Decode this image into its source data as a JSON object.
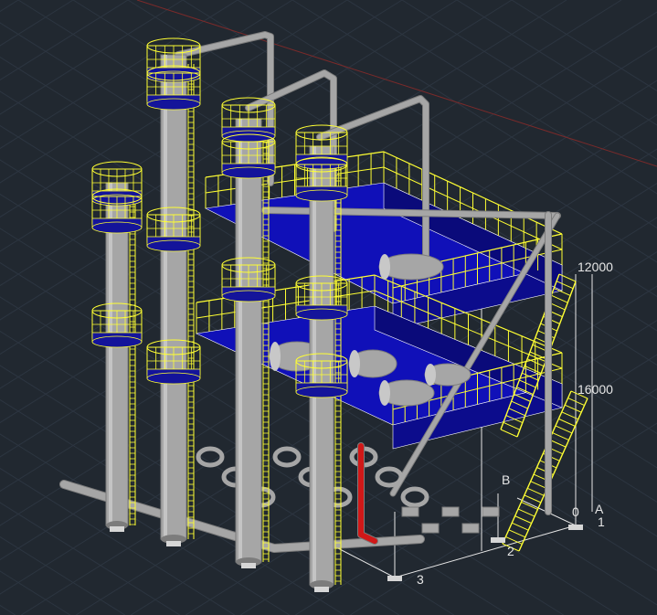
{
  "viewport": {
    "title": "",
    "background_color": "#212830",
    "grid_color": "#2c3540",
    "axis_color": "#7a2a2a"
  },
  "colors": {
    "platform": "#1010b8",
    "railing": "#ffff33",
    "pipe": "#a6a6a6",
    "pipe_dark": "#7c7c7c",
    "column_band": "#14149a",
    "highlight_pipe": "#d01818",
    "dimension": "#e6e6e6"
  },
  "annotations": {
    "elevation_upper": "12000",
    "elevation_lower": "16000",
    "grid_label_b": "B",
    "grid_label_a": "A",
    "grid_label_0": "0",
    "grid_label_1": "1",
    "grid_label_2": "2",
    "grid_label_3": "3"
  },
  "icons": {
    "viewport": "3d-model-viewport",
    "columns": "distillation-column-icon",
    "platform": "steel-platform-icon",
    "stair": "stair-icon"
  }
}
